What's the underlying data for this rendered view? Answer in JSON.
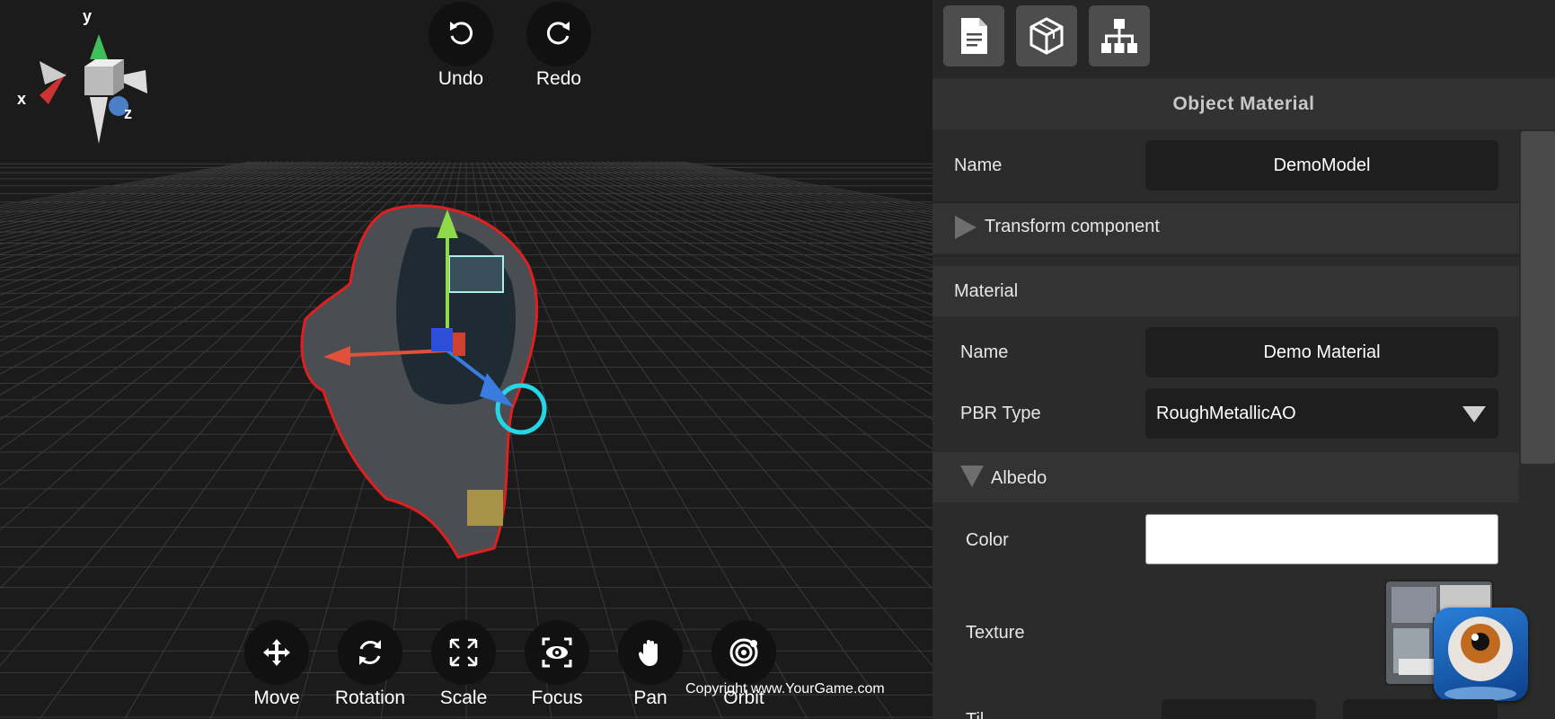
{
  "viewport": {
    "axes": {
      "x": "x",
      "y": "y",
      "z": "z"
    },
    "history": {
      "undo": {
        "label": "Undo",
        "icon": "undo-icon"
      },
      "redo": {
        "label": "Redo",
        "icon": "redo-icon"
      }
    },
    "tools": [
      {
        "label": "Move",
        "icon": "move-icon"
      },
      {
        "label": "Rotation",
        "icon": "rotation-icon"
      },
      {
        "label": "Scale",
        "icon": "scale-icon"
      },
      {
        "label": "Focus",
        "icon": "focus-icon"
      },
      {
        "label": "Pan",
        "icon": "pan-icon"
      },
      {
        "label": "Orbit",
        "icon": "orbit-icon"
      }
    ],
    "copyright": "Copyright www.YourGame.com"
  },
  "panel": {
    "top_icons": [
      "document-icon",
      "cube-icon",
      "hierarchy-icon"
    ],
    "title": "Object Material",
    "object": {
      "name_label": "Name",
      "name_value": "DemoModel"
    },
    "transform_section": "Transform component",
    "material_section": "Material",
    "material": {
      "name_label": "Name",
      "name_value": "Demo Material",
      "pbr_label": "PBR Type",
      "pbr_value": "RoughMetallicAO"
    },
    "albedo_section": "Albedo",
    "albedo": {
      "color_label": "Color",
      "color_value": "#ffffff",
      "texture_label": "Texture",
      "partial_label": "Til"
    }
  },
  "colors": {
    "viewport_bg": "#1b1b1b",
    "panel_bg": "#2b2b2b",
    "field_bg": "#1e1e1e",
    "selection_outline": "#e02020",
    "gizmo_x": "#e0503a",
    "gizmo_y": "#8fd94a",
    "gizmo_z": "#3a7be0"
  }
}
